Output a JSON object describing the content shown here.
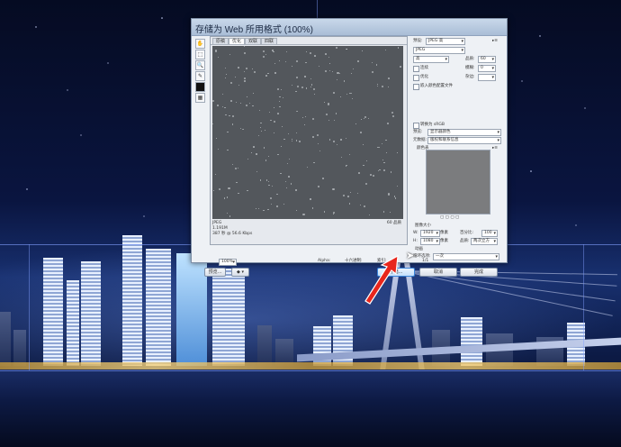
{
  "dialog": {
    "title": "存储为 Web 所用格式 (100%)",
    "preview_tabs": [
      "原稿",
      "优化",
      "双联",
      "四联"
    ],
    "preview_info_left": [
      "JPEG",
      "1.191M",
      "387 秒 @ 56.6 Kbps"
    ],
    "preview_info_right": "60 品质",
    "status": {
      "zoom": "100%",
      "alpha_label": "Alpha:",
      "hex_label": "十六进制:",
      "index_label": "索引:"
    },
    "tools": [
      "hand-tool-icon",
      "slice-select-icon",
      "zoom-tool-icon",
      "eyedropper-icon",
      "color-swatch-icon",
      "toggle-slices-icon"
    ],
    "settings": {
      "preset_label": "预设:",
      "preset_value": "JPEG 高",
      "format_value": "JPEG",
      "quality_name": "高",
      "quality_label": "品质:",
      "quality_value": "60",
      "progressive_label": "连续",
      "blur_label": "模糊:",
      "blur_value": "0",
      "optimized_label": "优化",
      "matte_label": "杂边:",
      "embed_profile_label": "嵌入颜色配置文件",
      "convert_srgb_label": "转换为 sRGB",
      "preview_label": "预览:",
      "preview_value": "显示器颜色",
      "metadata_label": "元数据:",
      "metadata_value": "版权和联系信息",
      "color_table_label": "颜色表",
      "image_size_label": "图像大小",
      "width_label": "W:",
      "width_value": "1920",
      "height_label": "H:",
      "height_value": "1080",
      "pixels_label": "像素",
      "percent_label": "百分比:",
      "percent_value": "100",
      "quality_resample_label": "品质:",
      "quality_resample_value": "两次立方",
      "animation_label": "动画",
      "loop_label": "循环选项:",
      "loop_value": "一次",
      "frame_counter": "1/1"
    },
    "buttons": {
      "preview_button": "预览...",
      "browser_menu": "◆ ▾",
      "save": "存储...",
      "cancel": "取消",
      "done": "完成"
    }
  },
  "colors": {
    "arrow": "#e8261c",
    "dialog_bg": "#eef1f5",
    "preview_bg": "#53575c"
  }
}
